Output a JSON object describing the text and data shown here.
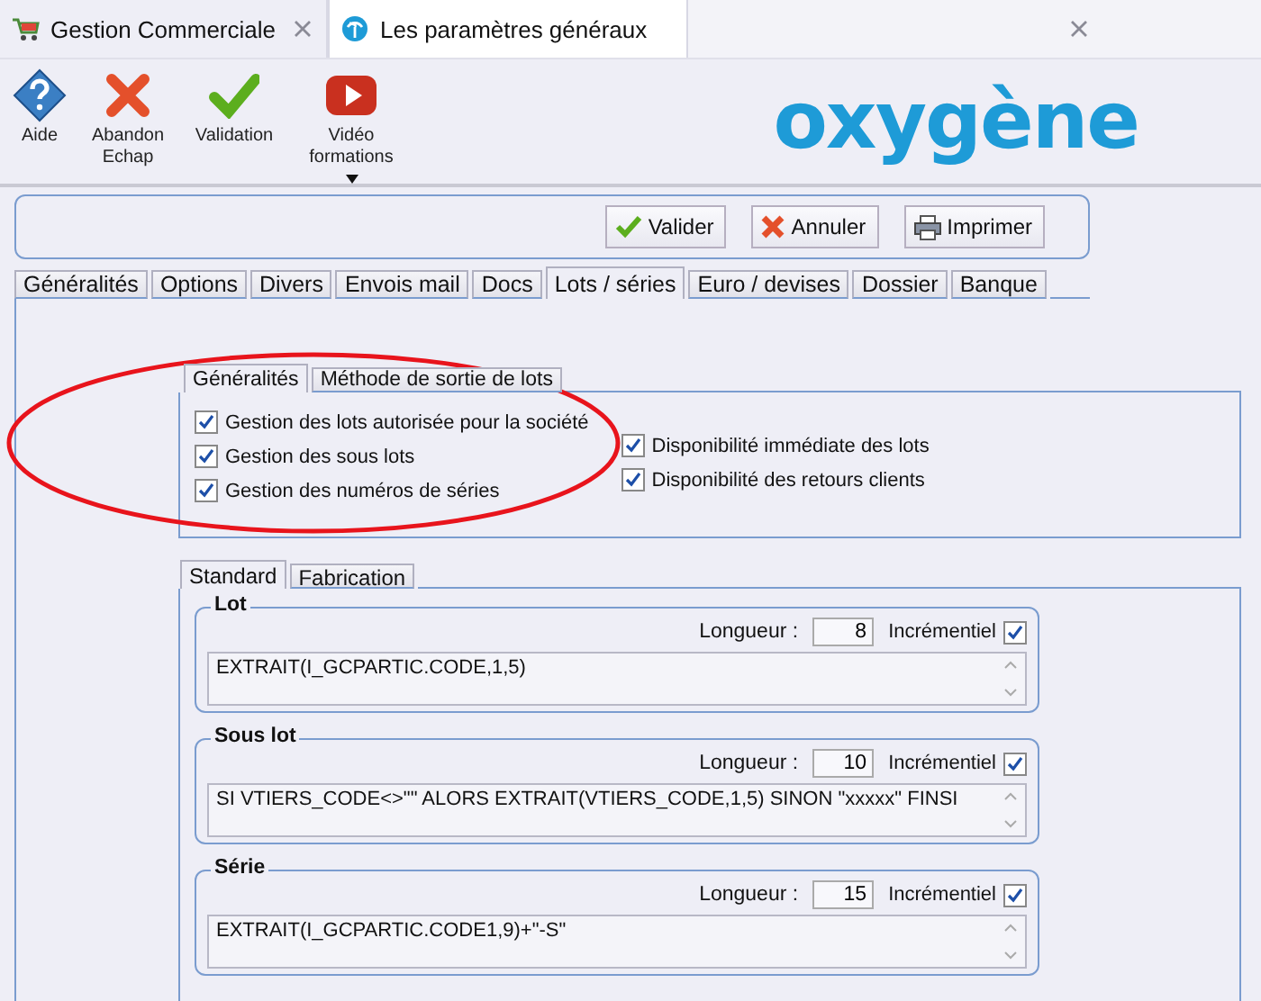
{
  "app_tabs": [
    {
      "label": "Gestion Commerciale",
      "selected": false,
      "kind": "cart"
    },
    {
      "label": "Les paramètres généraux",
      "selected": true,
      "kind": "logo"
    }
  ],
  "toolbar": [
    {
      "kind": "help",
      "lines": [
        "Aide"
      ]
    },
    {
      "kind": "cancel",
      "lines": [
        "Abandon",
        "Echap"
      ]
    },
    {
      "kind": "validate",
      "lines": [
        "Validation"
      ]
    },
    {
      "kind": "video",
      "lines": [
        "Vidéo",
        "formations"
      ],
      "dropdown": true
    }
  ],
  "logo": "oxygène",
  "actions": [
    {
      "kind": "validate",
      "label": "Valider"
    },
    {
      "kind": "cancel",
      "label": "Annuler"
    },
    {
      "kind": "print",
      "label": "Imprimer"
    }
  ],
  "tabs": [
    {
      "label": "Généralités",
      "selected": false
    },
    {
      "label": "Options",
      "selected": false
    },
    {
      "label": "Divers",
      "selected": false
    },
    {
      "label": "Envois mail",
      "selected": false
    },
    {
      "label": "Docs",
      "selected": false
    },
    {
      "label": "Lots / séries",
      "selected": true
    },
    {
      "label": "Euro / devises",
      "selected": false
    },
    {
      "label": "Dossier",
      "selected": false
    },
    {
      "label": "Banque",
      "selected": false
    }
  ],
  "sub_tabs": [
    {
      "label": "Généralités",
      "selected": true
    },
    {
      "label": "Méthode de sortie de lots",
      "selected": false
    }
  ],
  "options_left": [
    {
      "label": "Gestion des lots autorisée pour la société",
      "checked": true
    },
    {
      "label": "Gestion des sous lots",
      "checked": true
    },
    {
      "label": "Gestion des numéros de séries",
      "checked": true
    }
  ],
  "options_right": [
    {
      "label": "Disponibilité immédiate des lots",
      "checked": true
    },
    {
      "label": "Disponibilité des retours clients",
      "checked": true
    }
  ],
  "mode_tabs": [
    {
      "label": "Standard",
      "selected": true
    },
    {
      "label": "Fabrication",
      "selected": false
    }
  ],
  "groups": [
    {
      "title": "Lot",
      "length_label": "Longueur :",
      "length": "8",
      "incremental_label": "Incrémentiel",
      "incremental": true,
      "formula": "EXTRAIT(I_GCPARTIC.CODE,1,5)"
    },
    {
      "title": "Sous lot",
      "length_label": "Longueur :",
      "length": "10",
      "incremental_label": "Incrémentiel",
      "incremental": true,
      "formula": "SI VTIERS_CODE<>\"\" ALORS EXTRAIT(VTIERS_CODE,1,5) SINON \"xxxxx\" FINSI"
    },
    {
      "title": "Série",
      "length_label": "Longueur :",
      "length": "15",
      "incremental_label": "Incrémentiel",
      "incremental": true,
      "formula": "EXTRAIT(I_GCPARTIC.CODE1,9)+\"-S\""
    }
  ],
  "annotation": {
    "kind": "ellipse",
    "color": "#e8141c"
  }
}
